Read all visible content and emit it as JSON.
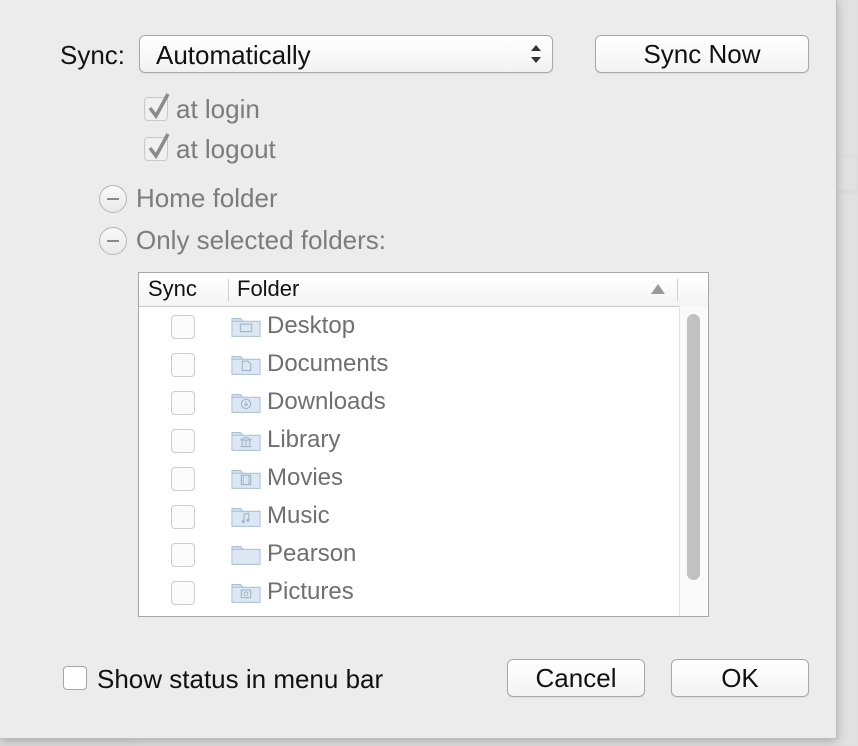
{
  "sync": {
    "label": "Sync:",
    "mode_value": "Automatically",
    "sync_now_label": "Sync Now",
    "at_login_label": "at login",
    "at_logout_label": "at logout",
    "home_folder_label": "Home folder",
    "selected_folders_label": "Only selected folders:"
  },
  "table": {
    "col_sync": "Sync",
    "col_folder": "Folder",
    "rows": [
      {
        "name": "Desktop",
        "icon": "desktop-folder-icon"
      },
      {
        "name": "Documents",
        "icon": "documents-folder-icon"
      },
      {
        "name": "Downloads",
        "icon": "downloads-folder-icon"
      },
      {
        "name": "Library",
        "icon": "library-folder-icon"
      },
      {
        "name": "Movies",
        "icon": "movies-folder-icon"
      },
      {
        "name": "Music",
        "icon": "music-folder-icon"
      },
      {
        "name": "Pearson",
        "icon": "generic-folder-icon"
      },
      {
        "name": "Pictures",
        "icon": "pictures-folder-icon"
      }
    ]
  },
  "footer": {
    "show_status_label": "Show status in menu bar",
    "cancel_label": "Cancel",
    "ok_label": "OK"
  }
}
